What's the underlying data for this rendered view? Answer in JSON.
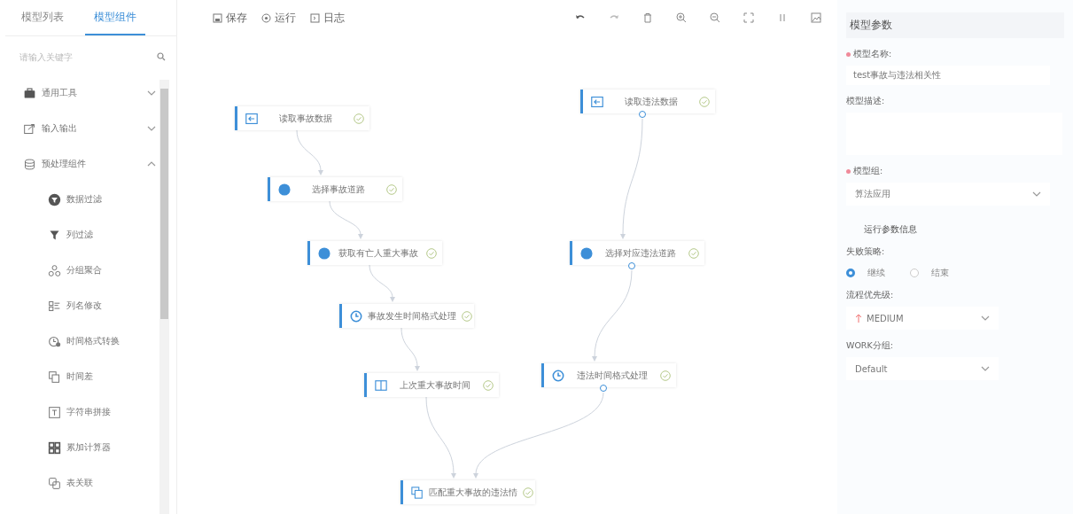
{
  "sidebar": {
    "tabs": [
      {
        "label": "模型列表",
        "selected": false
      },
      {
        "label": "模型组件",
        "selected": true
      }
    ],
    "search": {
      "placeholder": "请输入关键字"
    },
    "groups": [
      {
        "label": "通用工具",
        "kind": "briefcase",
        "expanded": false
      },
      {
        "label": "输入输出",
        "kind": "export",
        "expanded": false
      },
      {
        "label": "预处理组件",
        "kind": "database",
        "expanded": true,
        "children": [
          {
            "label": "数据过滤",
            "kind": "filter"
          },
          {
            "label": "列过滤",
            "kind": "funnel"
          },
          {
            "label": "分组聚合",
            "kind": "triangle"
          },
          {
            "label": "列名修改",
            "kind": "list"
          },
          {
            "label": "时间格式转换",
            "kind": "clock"
          },
          {
            "label": "时间差",
            "kind": "copy"
          },
          {
            "label": "字符串拼接",
            "kind": "text"
          },
          {
            "label": "累加计算器",
            "kind": "grid"
          },
          {
            "label": "表关联",
            "kind": "link"
          }
        ]
      }
    ]
  },
  "toolbar": {
    "actions": [
      {
        "label": "保存",
        "kind": "save"
      },
      {
        "label": "运行",
        "kind": "run"
      },
      {
        "label": "日志",
        "kind": "log"
      }
    ]
  },
  "canvas": {
    "nodes": [
      {
        "label": "读取事故数据",
        "kind": "input",
        "output_port": false
      },
      {
        "label": "选择事故道路",
        "kind": "dot",
        "output_port": false
      },
      {
        "label": "获取有亡人重大事故",
        "kind": "dot",
        "output_port": false
      },
      {
        "label": "事故发生时间格式处理",
        "kind": "clock",
        "output_port": false
      },
      {
        "label": "上次重大事故时间",
        "kind": "columns",
        "output_port": false
      },
      {
        "label": "匹配重大事故的违法情",
        "kind": "copy",
        "output_port": false
      },
      {
        "label": "读取违法数据",
        "kind": "input",
        "output_port": true
      },
      {
        "label": "选择对应违法道路",
        "kind": "dot",
        "output_port": true
      },
      {
        "label": "违法时间格式处理",
        "kind": "clock",
        "output_port": true
      }
    ]
  },
  "panel": {
    "title": "模型参数",
    "name": {
      "label": "模型名称:",
      "required": true,
      "value": "test事故与违法相关性"
    },
    "description": {
      "label": "模型描述:"
    },
    "group": {
      "label": "模型组:",
      "required": true,
      "value": "算法应用"
    },
    "section": "运行参数信息",
    "strategy": {
      "label": "失败策略:",
      "options": [
        {
          "label": "继续",
          "selected": true
        },
        {
          "label": "结束",
          "selected": false
        }
      ]
    },
    "priority": {
      "label": "流程优先级:",
      "value": "MEDIUM"
    },
    "work_group": {
      "label": "WORK分组:",
      "value": "Default"
    }
  }
}
